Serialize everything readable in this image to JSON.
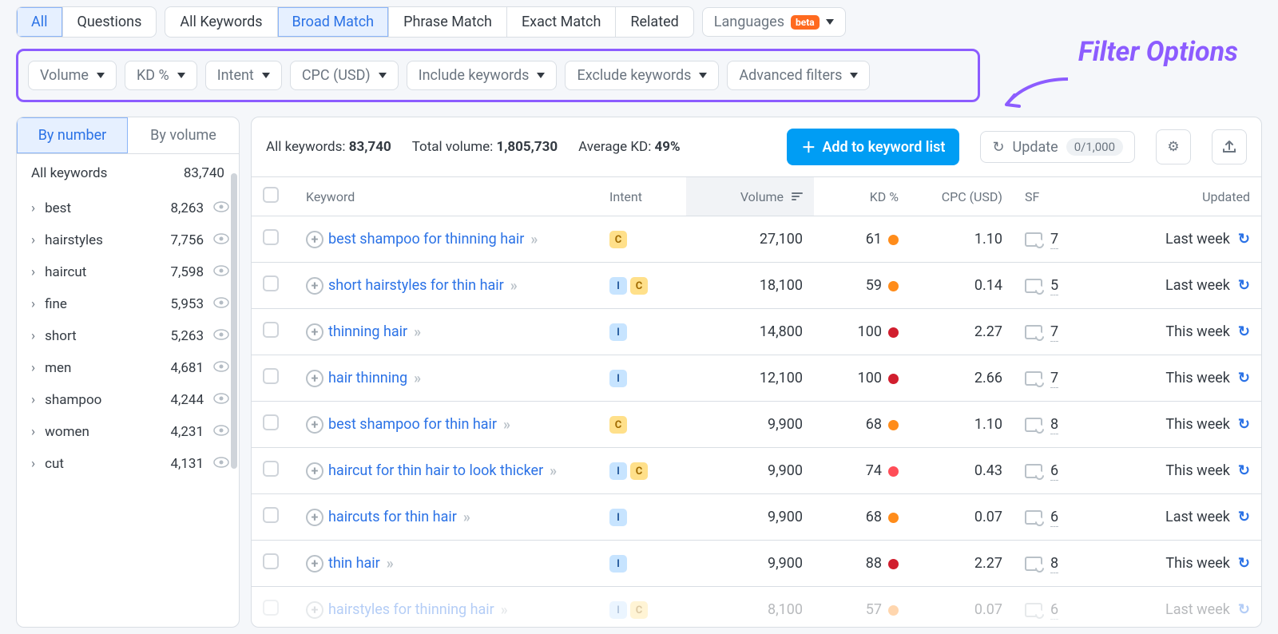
{
  "tabs_a": [
    {
      "label": "All",
      "active": true
    },
    {
      "label": "Questions",
      "active": false
    }
  ],
  "tabs_b": [
    {
      "label": "All Keywords",
      "active": false
    },
    {
      "label": "Broad Match",
      "active": true
    },
    {
      "label": "Phrase Match",
      "active": false
    },
    {
      "label": "Exact Match",
      "active": false
    },
    {
      "label": "Related",
      "active": false
    }
  ],
  "languages": {
    "label": "Languages",
    "badge": "beta"
  },
  "filters": [
    {
      "label": "Volume"
    },
    {
      "label": "KD %"
    },
    {
      "label": "Intent"
    },
    {
      "label": "CPC (USD)"
    },
    {
      "label": "Include keywords"
    },
    {
      "label": "Exclude keywords"
    },
    {
      "label": "Advanced filters"
    }
  ],
  "filter_annotation": "Filter Options",
  "sidebar": {
    "toggle": [
      {
        "label": "By number",
        "active": true
      },
      {
        "label": "By volume",
        "active": false
      }
    ],
    "all_label": "All keywords",
    "all_count": "83,740",
    "items": [
      {
        "label": "best",
        "count": "8,263"
      },
      {
        "label": "hairstyles",
        "count": "7,756"
      },
      {
        "label": "haircut",
        "count": "7,598"
      },
      {
        "label": "fine",
        "count": "5,953"
      },
      {
        "label": "short",
        "count": "5,263"
      },
      {
        "label": "men",
        "count": "4,681"
      },
      {
        "label": "shampoo",
        "count": "4,244"
      },
      {
        "label": "women",
        "count": "4,231"
      },
      {
        "label": "cut",
        "count": "4,131"
      }
    ]
  },
  "summary": {
    "all_label": "All keywords:",
    "all_value": "83,740",
    "vol_label": "Total volume:",
    "vol_value": "1,805,730",
    "kd_label": "Average KD:",
    "kd_value": "49%",
    "add_btn": "Add to keyword list",
    "update_btn": "Update",
    "update_pill": "0/1,000"
  },
  "cols": {
    "keyword": "Keyword",
    "intent": "Intent",
    "volume": "Volume",
    "kd": "KD %",
    "cpc": "CPC (USD)",
    "sf": "SF",
    "updated": "Updated"
  },
  "rows": [
    {
      "kw": "best shampoo for thinning hair",
      "intent": [
        "C"
      ],
      "vol": "27,100",
      "kd": "61",
      "kdc": "orange",
      "cpc": "1.10",
      "sf": "7",
      "upd": "Last week"
    },
    {
      "kw": "short hairstyles for thin hair",
      "intent": [
        "I",
        "C"
      ],
      "vol": "18,100",
      "kd": "59",
      "kdc": "orange",
      "cpc": "0.14",
      "sf": "5",
      "upd": "Last week"
    },
    {
      "kw": "thinning hair",
      "intent": [
        "I"
      ],
      "vol": "14,800",
      "kd": "100",
      "kdc": "red",
      "cpc": "2.27",
      "sf": "7",
      "upd": "This week"
    },
    {
      "kw": "hair thinning",
      "intent": [
        "I"
      ],
      "vol": "12,100",
      "kd": "100",
      "kdc": "red",
      "cpc": "2.66",
      "sf": "7",
      "upd": "This week"
    },
    {
      "kw": "best shampoo for thin hair",
      "intent": [
        "C"
      ],
      "vol": "9,900",
      "kd": "68",
      "kdc": "orange",
      "cpc": "1.10",
      "sf": "8",
      "upd": "This week"
    },
    {
      "kw": "haircut for thin hair to look thicker",
      "intent": [
        "I",
        "C"
      ],
      "vol": "9,900",
      "kd": "74",
      "kdc": "lred",
      "cpc": "0.43",
      "sf": "6",
      "upd": "This week"
    },
    {
      "kw": "haircuts for thin hair",
      "intent": [
        "I"
      ],
      "vol": "9,900",
      "kd": "68",
      "kdc": "orange",
      "cpc": "0.07",
      "sf": "6",
      "upd": "Last week"
    },
    {
      "kw": "thin hair",
      "intent": [
        "I"
      ],
      "vol": "9,900",
      "kd": "88",
      "kdc": "red",
      "cpc": "2.27",
      "sf": "8",
      "upd": "This week"
    },
    {
      "kw": "hairstyles for thinning hair",
      "intent": [
        "I",
        "C"
      ],
      "vol": "8,100",
      "kd": "57",
      "kdc": "orange",
      "cpc": "0.07",
      "sf": "6",
      "upd": "Last week",
      "faded": true
    }
  ]
}
